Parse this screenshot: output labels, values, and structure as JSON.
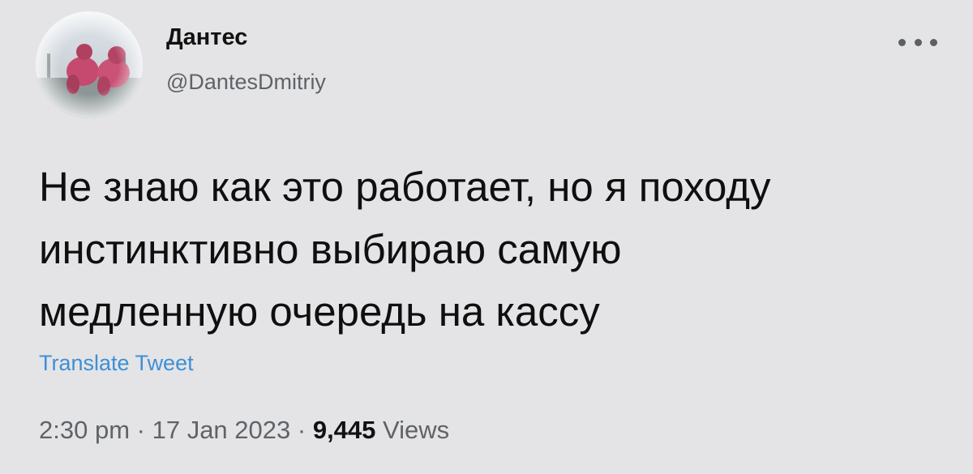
{
  "author": {
    "display_name": "Дантес",
    "handle": "@DantesDmitriy",
    "avatar_icon": "avatar-photo"
  },
  "tweet": {
    "text_lines": [
      "Не знаю как это работает, но я походу",
      "инстинктивно выбираю самую",
      "медленную очередь на кассу"
    ],
    "translate_label": "Translate Tweet"
  },
  "meta": {
    "time": "2:30 pm",
    "separator": "·",
    "date": "17 Jan 2023",
    "views_count": "9,445",
    "views_label": "Views"
  },
  "icons": {
    "more": "more-options-icon"
  },
  "colors": {
    "background": "#e4e4e6",
    "link": "#3e8fd6",
    "secondary_text": "#5f6368"
  }
}
